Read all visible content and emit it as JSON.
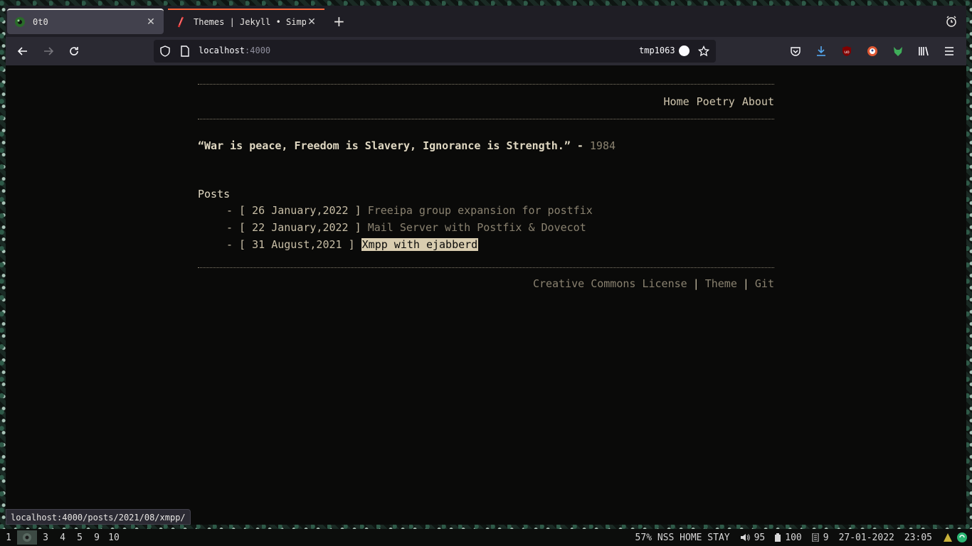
{
  "tabs": [
    {
      "title": "0t0",
      "close": "✕"
    },
    {
      "title": "Themes | Jekyll • Simple, blog-aware, static sites",
      "close": "✕"
    }
  ],
  "new_tab": "+",
  "address": {
    "host": "localhost",
    "port": ":4000"
  },
  "container": "tmp1063",
  "site": {
    "nav": [
      "Home",
      "Poetry",
      "About"
    ],
    "quote": "“War is peace, Freedom is Slavery, Ignorance is Strength.”",
    "quote_dash": " - ",
    "quote_source": "1984",
    "posts_title": "Posts",
    "posts": [
      {
        "date": "26 January,2022",
        "title": "Freeipa group expansion for postfix"
      },
      {
        "date": "22 January,2022",
        "title": "Mail Server with Postfix & Dovecot"
      },
      {
        "date": "31 August,2021",
        "title": "Xmpp with ejabberd"
      }
    ],
    "post_prefix": "- [ ",
    "post_suffix": " ] ",
    "footer": [
      "Creative Commons License",
      "Theme",
      "Git"
    ],
    "footer_sep": "|"
  },
  "status_url": "localhost:4000/posts/2021/08/xmpp/",
  "wm": {
    "workspaces": [
      "1",
      "",
      "3",
      "4",
      "5",
      "9",
      "10"
    ],
    "active_workspace": 1,
    "mode": "57% NSS HOME STAY",
    "volume": "95",
    "battery": "100",
    "memory": "9",
    "date": "27-01-2022",
    "time": "23:05"
  },
  "colors": {
    "accent_tab": "#ff6a3d",
    "text": "#c8bea6",
    "muted": "#8a8270",
    "highlight": "#d9cdb0"
  }
}
